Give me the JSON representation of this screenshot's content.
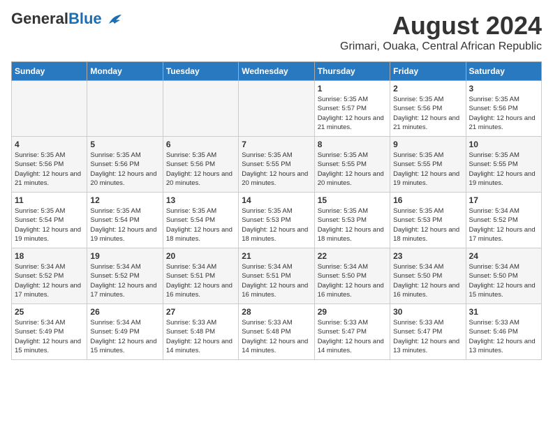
{
  "header": {
    "logo_general": "General",
    "logo_blue": "Blue",
    "title": "August 2024",
    "subtitle": "Grimari, Ouaka, Central African Republic"
  },
  "days_of_week": [
    "Sunday",
    "Monday",
    "Tuesday",
    "Wednesday",
    "Thursday",
    "Friday",
    "Saturday"
  ],
  "weeks": [
    {
      "row_class": "row-odd",
      "cells": [
        {
          "day": "",
          "empty": true
        },
        {
          "day": "",
          "empty": true
        },
        {
          "day": "",
          "empty": true
        },
        {
          "day": "",
          "empty": true
        },
        {
          "day": "1",
          "sunrise": "5:35 AM",
          "sunset": "5:57 PM",
          "daylight": "12 hours and 21 minutes."
        },
        {
          "day": "2",
          "sunrise": "5:35 AM",
          "sunset": "5:56 PM",
          "daylight": "12 hours and 21 minutes."
        },
        {
          "day": "3",
          "sunrise": "5:35 AM",
          "sunset": "5:56 PM",
          "daylight": "12 hours and 21 minutes."
        }
      ]
    },
    {
      "row_class": "row-even",
      "cells": [
        {
          "day": "4",
          "sunrise": "5:35 AM",
          "sunset": "5:56 PM",
          "daylight": "12 hours and 21 minutes."
        },
        {
          "day": "5",
          "sunrise": "5:35 AM",
          "sunset": "5:56 PM",
          "daylight": "12 hours and 20 minutes."
        },
        {
          "day": "6",
          "sunrise": "5:35 AM",
          "sunset": "5:56 PM",
          "daylight": "12 hours and 20 minutes."
        },
        {
          "day": "7",
          "sunrise": "5:35 AM",
          "sunset": "5:55 PM",
          "daylight": "12 hours and 20 minutes."
        },
        {
          "day": "8",
          "sunrise": "5:35 AM",
          "sunset": "5:55 PM",
          "daylight": "12 hours and 20 minutes."
        },
        {
          "day": "9",
          "sunrise": "5:35 AM",
          "sunset": "5:55 PM",
          "daylight": "12 hours and 19 minutes."
        },
        {
          "day": "10",
          "sunrise": "5:35 AM",
          "sunset": "5:55 PM",
          "daylight": "12 hours and 19 minutes."
        }
      ]
    },
    {
      "row_class": "row-odd",
      "cells": [
        {
          "day": "11",
          "sunrise": "5:35 AM",
          "sunset": "5:54 PM",
          "daylight": "12 hours and 19 minutes."
        },
        {
          "day": "12",
          "sunrise": "5:35 AM",
          "sunset": "5:54 PM",
          "daylight": "12 hours and 19 minutes."
        },
        {
          "day": "13",
          "sunrise": "5:35 AM",
          "sunset": "5:54 PM",
          "daylight": "12 hours and 18 minutes."
        },
        {
          "day": "14",
          "sunrise": "5:35 AM",
          "sunset": "5:53 PM",
          "daylight": "12 hours and 18 minutes."
        },
        {
          "day": "15",
          "sunrise": "5:35 AM",
          "sunset": "5:53 PM",
          "daylight": "12 hours and 18 minutes."
        },
        {
          "day": "16",
          "sunrise": "5:35 AM",
          "sunset": "5:53 PM",
          "daylight": "12 hours and 18 minutes."
        },
        {
          "day": "17",
          "sunrise": "5:34 AM",
          "sunset": "5:52 PM",
          "daylight": "12 hours and 17 minutes."
        }
      ]
    },
    {
      "row_class": "row-even",
      "cells": [
        {
          "day": "18",
          "sunrise": "5:34 AM",
          "sunset": "5:52 PM",
          "daylight": "12 hours and 17 minutes."
        },
        {
          "day": "19",
          "sunrise": "5:34 AM",
          "sunset": "5:52 PM",
          "daylight": "12 hours and 17 minutes."
        },
        {
          "day": "20",
          "sunrise": "5:34 AM",
          "sunset": "5:51 PM",
          "daylight": "12 hours and 16 minutes."
        },
        {
          "day": "21",
          "sunrise": "5:34 AM",
          "sunset": "5:51 PM",
          "daylight": "12 hours and 16 minutes."
        },
        {
          "day": "22",
          "sunrise": "5:34 AM",
          "sunset": "5:50 PM",
          "daylight": "12 hours and 16 minutes."
        },
        {
          "day": "23",
          "sunrise": "5:34 AM",
          "sunset": "5:50 PM",
          "daylight": "12 hours and 16 minutes."
        },
        {
          "day": "24",
          "sunrise": "5:34 AM",
          "sunset": "5:50 PM",
          "daylight": "12 hours and 15 minutes."
        }
      ]
    },
    {
      "row_class": "row-odd",
      "cells": [
        {
          "day": "25",
          "sunrise": "5:34 AM",
          "sunset": "5:49 PM",
          "daylight": "12 hours and 15 minutes."
        },
        {
          "day": "26",
          "sunrise": "5:34 AM",
          "sunset": "5:49 PM",
          "daylight": "12 hours and 15 minutes."
        },
        {
          "day": "27",
          "sunrise": "5:33 AM",
          "sunset": "5:48 PM",
          "daylight": "12 hours and 14 minutes."
        },
        {
          "day": "28",
          "sunrise": "5:33 AM",
          "sunset": "5:48 PM",
          "daylight": "12 hours and 14 minutes."
        },
        {
          "day": "29",
          "sunrise": "5:33 AM",
          "sunset": "5:47 PM",
          "daylight": "12 hours and 14 minutes."
        },
        {
          "day": "30",
          "sunrise": "5:33 AM",
          "sunset": "5:47 PM",
          "daylight": "12 hours and 13 minutes."
        },
        {
          "day": "31",
          "sunrise": "5:33 AM",
          "sunset": "5:46 PM",
          "daylight": "12 hours and 13 minutes."
        }
      ]
    }
  ],
  "labels": {
    "sunrise_prefix": "Sunrise: ",
    "sunset_prefix": "Sunset: ",
    "daylight_prefix": "Daylight: "
  }
}
